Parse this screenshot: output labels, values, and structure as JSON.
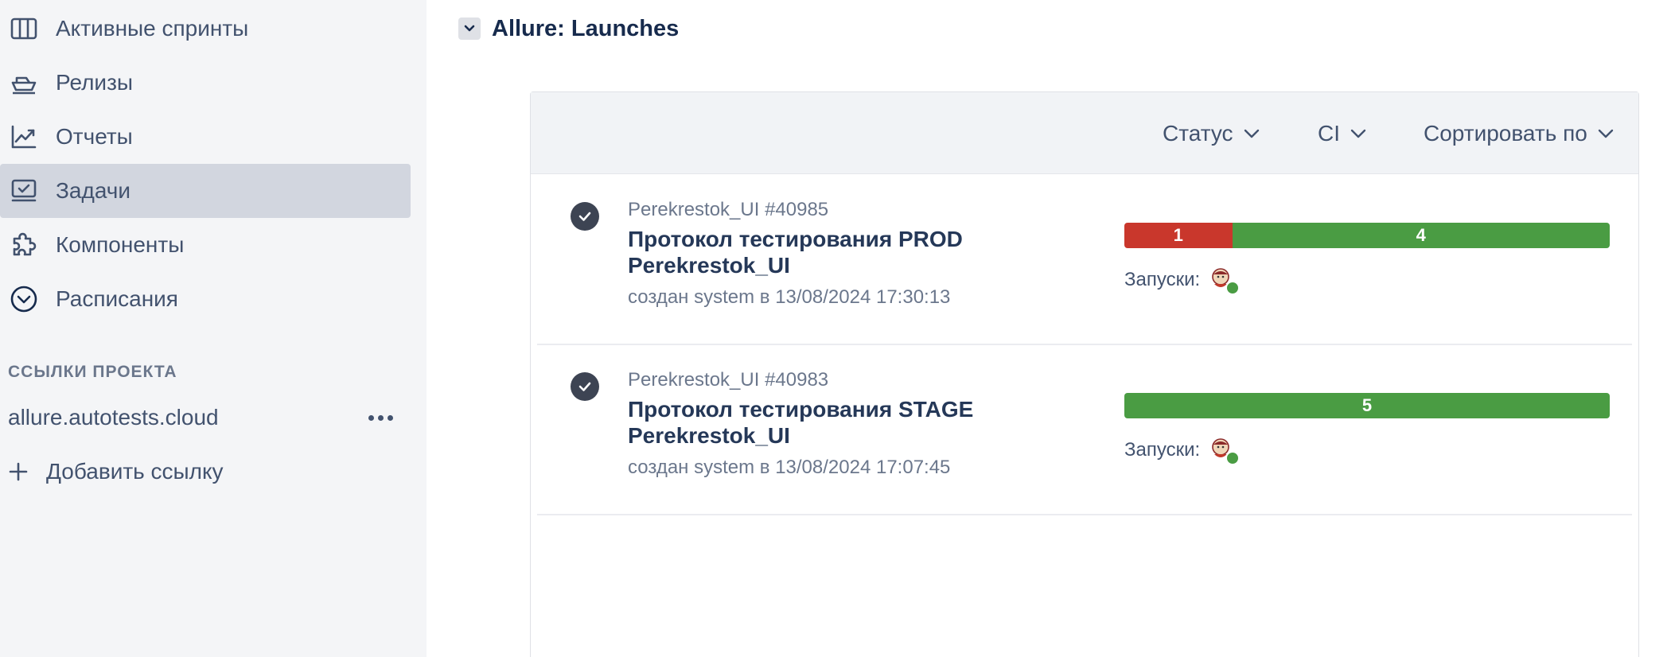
{
  "sidebar": {
    "items": [
      {
        "label": "Активные спринты",
        "icon": "columns-icon"
      },
      {
        "label": "Релизы",
        "icon": "ship-icon"
      },
      {
        "label": "Отчеты",
        "icon": "trend-chart-icon"
      },
      {
        "label": "Задачи",
        "icon": "task-board-icon",
        "active": true
      },
      {
        "label": "Компоненты",
        "icon": "puzzle-icon"
      },
      {
        "label": "Расписания",
        "icon": "clock-chevron-icon"
      }
    ],
    "links_heading": "ССЫЛКИ ПРОЕКТА",
    "links": [
      {
        "label": "allure.autotests.cloud"
      }
    ],
    "add_link_label": "Добавить ссылку"
  },
  "main": {
    "title": "Allure: Launches",
    "filters": {
      "status": "Статус",
      "ci": "CI",
      "sort": "Сортировать по"
    },
    "launches": [
      {
        "id": "Perekrestok_UI #40985",
        "name": "Протокол тестирования PROD Perekrestok_UI",
        "meta": "создан system в 13/08/2024 17:30:13",
        "results": {
          "failed": 1,
          "passed": 4
        },
        "failed_label": "1",
        "passed_label": "4",
        "runs_label": "Запуски:"
      },
      {
        "id": "Perekrestok_UI #40983",
        "name": "Протокол тестирования STAGE Perekrestok_UI",
        "meta": "создан system в 13/08/2024 17:07:45",
        "results": {
          "failed": 0,
          "passed": 5
        },
        "passed_label": "5",
        "runs_label": "Запуски:"
      }
    ]
  },
  "colors": {
    "sidebar_bg": "#f4f5f7",
    "active_item_bg": "#d2d6df",
    "failed": "#c9372c",
    "passed": "#4a9c43",
    "toolbar_bg": "#f1f3f6"
  }
}
